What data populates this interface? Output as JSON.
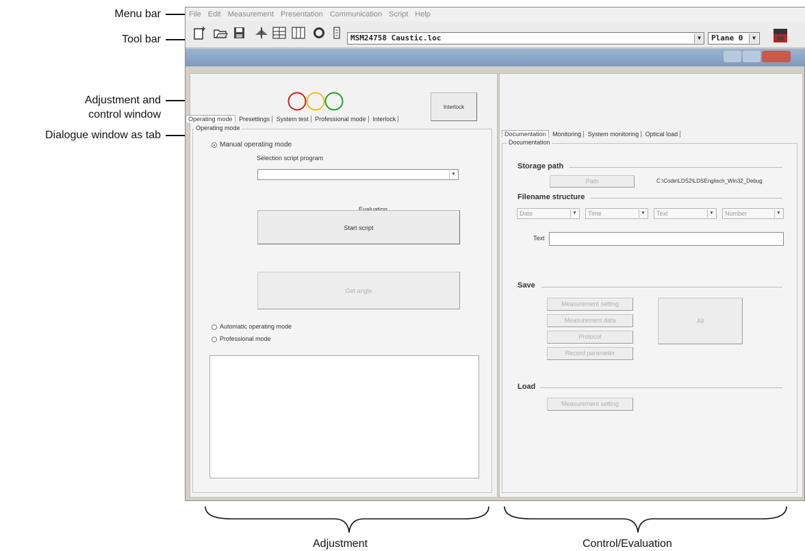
{
  "callouts": {
    "menu_bar": "Menu bar",
    "tool_bar": "Tool bar",
    "adjustment_line1": "Adjustment and",
    "adjustment_line2": "control window",
    "dialogue": "Dialogue window as tab"
  },
  "bottom_labels": {
    "left": "Adjustment",
    "right": "Control/Evaluation"
  },
  "menu": [
    "File",
    "Edit",
    "Measurement",
    "Presentation",
    "Communication",
    "Script",
    "Help"
  ],
  "toolbar": {
    "icons": [
      "new-file-icon",
      "open-folder-icon",
      "save-icon",
      "aircraft-icon",
      "grid-view-icon",
      "panel-view-icon",
      "ring-icon",
      "device-icon",
      "camera-device-icon"
    ],
    "file_combo": "MSM24758 Caustic.loc",
    "plane_combo": "Plane 0"
  },
  "status_lights": {
    "colors": [
      "#d42020",
      "#e8c020",
      "#20a030"
    ]
  },
  "interlock_button": "Interlock",
  "left_tabs": [
    "Operating mode",
    "Presettings",
    "System test",
    "Professional mode",
    "Interlock"
  ],
  "operating": {
    "group_title": "Operating mode",
    "manual_mode": "Manual operating mode",
    "selection_label": "Selection script program",
    "selection_value": "",
    "evaluation_label": "Evaluation",
    "start_script": "Start script",
    "disabled_button": "Get angle",
    "automatic_mode": "Automatic operating mode",
    "professional_mode": "Professional mode"
  },
  "right_tabs": [
    "Documentation",
    "Monitoring",
    "System monitoring",
    "Optical load"
  ],
  "documentation": {
    "group_title": "Documentation",
    "storage_path": {
      "heading": "Storage path",
      "button": "Path",
      "path_value": "C:\\Code\\LDS2\\LDSEnglisch_Win32_Debug"
    },
    "filename": {
      "heading": "Filename structure",
      "parts": [
        "Date",
        "Time",
        "Text",
        "Number"
      ],
      "text_label": "Text",
      "text_value": ""
    },
    "save": {
      "heading": "Save",
      "buttons": [
        "Measurement setting",
        "Measurement data",
        "Protocol",
        "Record parameter"
      ],
      "all_button": "All"
    },
    "load": {
      "heading": "Load",
      "button": "Measurement setting"
    }
  }
}
